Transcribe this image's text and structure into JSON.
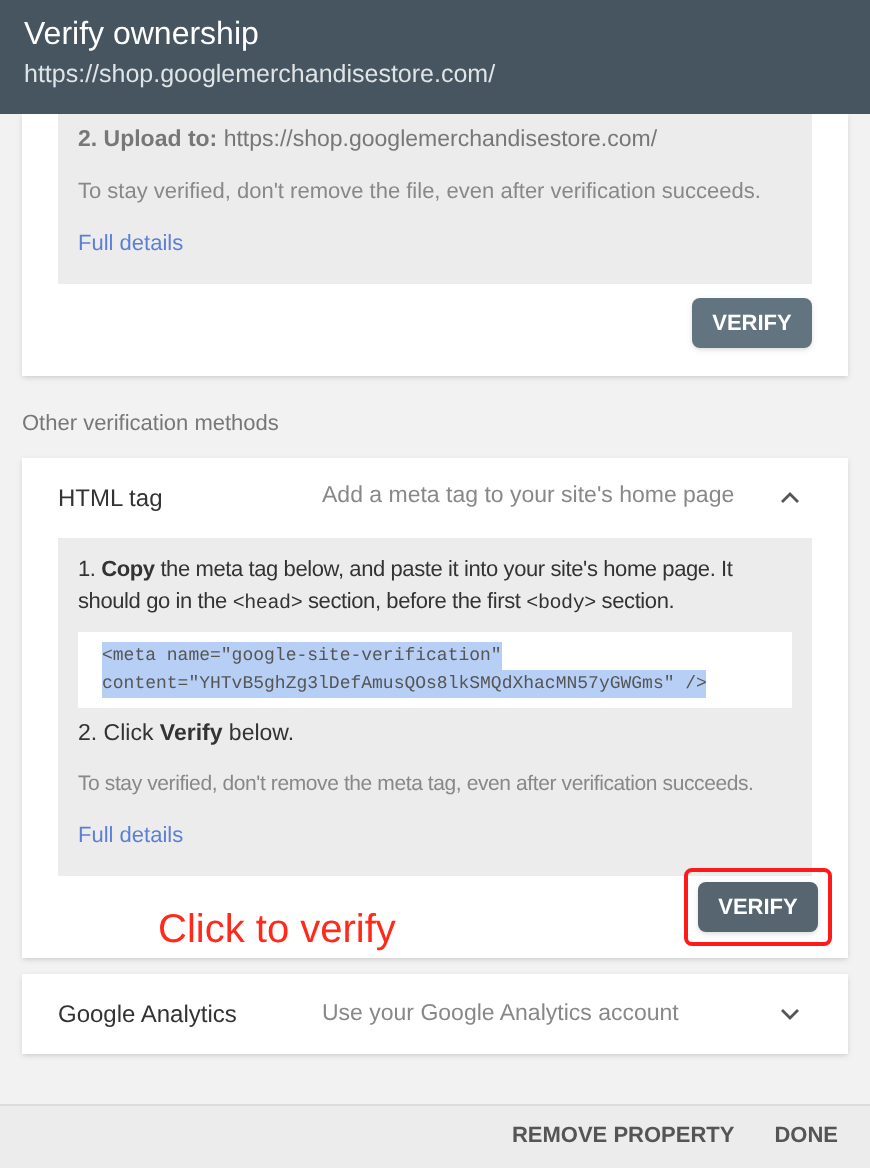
{
  "header": {
    "title": "Verify ownership",
    "url": "https://shop.googlemerchandisestore.com/"
  },
  "file_method": {
    "upload": "**2. Upload to:** https://shop.googlemerchandisestore.com/",
    "note": "To stay verified, don't remove the file, even after verification succeeds.",
    "link": "Full details",
    "button": "VERIFY"
  },
  "section_label": "Other verification methods",
  "methods": [
    {
      "name": "HTML tag",
      "description": "Add a meta tag to your site's home page",
      "expanded": true,
      "step1": [
        {
          "kind": "text",
          "text": "1. "
        },
        {
          "kind": "bold",
          "text": "Copy"
        },
        {
          "kind": "text",
          "text": " the meta tag below, and paste it into your site's home page. It should go in the "
        },
        {
          "kind": "code",
          "text": "<head>"
        },
        {
          "kind": "text",
          "text": " section, before the first "
        },
        {
          "kind": "code",
          "text": "<body>"
        },
        {
          "kind": "text",
          "text": " section."
        }
      ],
      "code": [
        "<meta name=\"google-site-verification\"",
        "content=\"YHTvB5ghZg3lDefAmusQOs8lkSMQdXhacMN57yGWGms\" />"
      ],
      "step2": "2. Click **Verify** below.",
      "note": "To stay verified, don't remove the meta tag, even after verification succeeds.",
      "link": "Full details",
      "button": "VERIFY",
      "annotation": "Click to verify"
    },
    {
      "name": "Google Analytics",
      "description": "Use your Google Analytics account",
      "expanded": false
    }
  ],
  "footer": {
    "buttons": [
      "REMOVE PROPERTY",
      "DONE"
    ]
  }
}
